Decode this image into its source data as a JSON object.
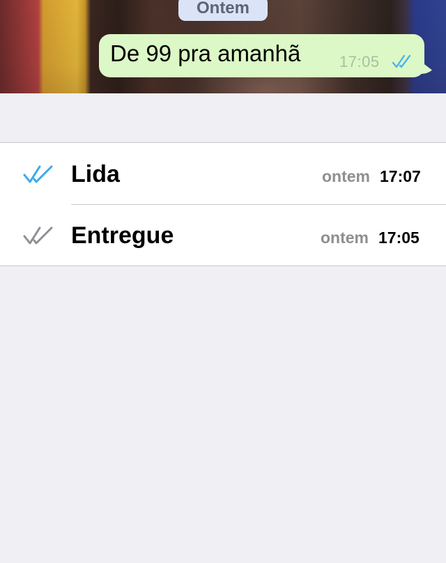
{
  "chat": {
    "date_separator": "Ontem",
    "message": {
      "text": "De 99 pra amanhã",
      "time": "17:05",
      "status_icon": "double-check-icon",
      "status_color": "#4fb3e8"
    },
    "bubble_color": "#dcf8c6"
  },
  "info": {
    "rows": [
      {
        "label": "Lida",
        "day": "ontem",
        "time": "17:07",
        "icon": "double-check-icon",
        "icon_color": "#3ea8ea"
      },
      {
        "label": "Entregue",
        "day": "ontem",
        "time": "17:05",
        "icon": "double-check-icon",
        "icon_color": "#8e8e93"
      }
    ]
  },
  "colors": {
    "background": "#efeff4",
    "read_tick": "#3ea8ea",
    "delivered_tick": "#8e8e93",
    "separator": "#c8c7cc"
  }
}
